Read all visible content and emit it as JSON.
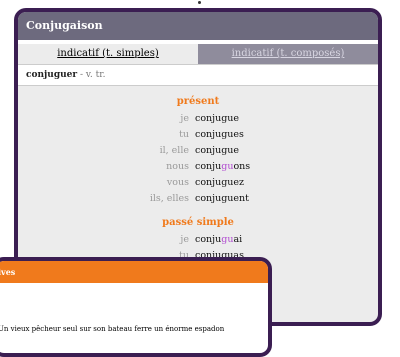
{
  "conjugation_window": {
    "title": "Conjugaison",
    "tabs": [
      {
        "label": "indicatif (t. simples)",
        "active": true
      },
      {
        "label": "indicatif (t. composés)",
        "active": false
      }
    ],
    "verb": "conjuguer",
    "grammar": " - v. tr."
  },
  "tenses": [
    {
      "name": "présent",
      "rows": [
        {
          "pronoun": "je",
          "stem": "conjugue",
          "hl": "",
          "tail": ""
        },
        {
          "pronoun": "tu",
          "stem": "conjugues",
          "hl": "",
          "tail": ""
        },
        {
          "pronoun": "il, elle",
          "stem": "conjugue",
          "hl": "",
          "tail": ""
        },
        {
          "pronoun": "nous",
          "stem": "conju",
          "hl": "gu",
          "tail": "ons"
        },
        {
          "pronoun": "vous",
          "stem": "conjuguez",
          "hl": "",
          "tail": ""
        },
        {
          "pronoun": "ils, elles",
          "stem": "conjuguent",
          "hl": "",
          "tail": ""
        }
      ]
    },
    {
      "name": "passé simple",
      "rows": [
        {
          "pronoun": "je",
          "stem": "conju",
          "hl": "gu",
          "tail": "ai"
        },
        {
          "pronoun": "tu",
          "stem": "conjuguas",
          "hl": "",
          "tail": ""
        }
      ]
    }
  ],
  "notes_window": {
    "title": "ives",
    "text": "Un vieux pêcheur seul sur son bateau ferre un énorme espadon"
  },
  "colors": {
    "accent": "#f07a1c",
    "highlight": "#b04bd0",
    "frame": "#3b1e52",
    "titlebar": "#6d6a7e"
  }
}
